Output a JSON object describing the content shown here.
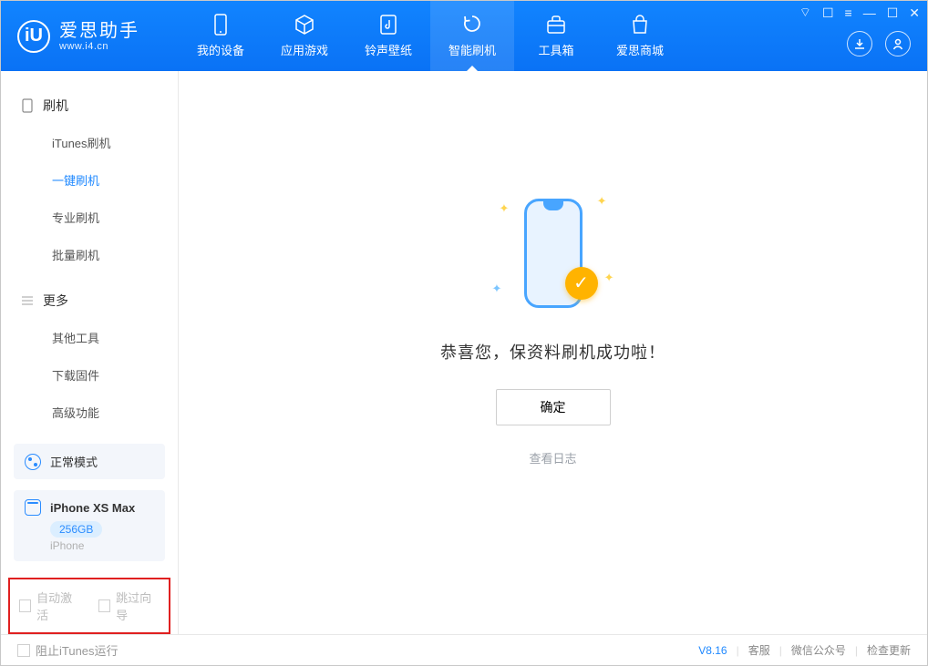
{
  "app": {
    "name_cn": "爱思助手",
    "url": "www.i4.cn"
  },
  "nav": {
    "device": "我的设备",
    "apps": "应用游戏",
    "ringtone": "铃声壁纸",
    "flash": "智能刷机",
    "toolbox": "工具箱",
    "store": "爱思商城"
  },
  "sidebar": {
    "section_flash": "刷机",
    "items_flash": {
      "itunes": "iTunes刷机",
      "oneclick": "一键刷机",
      "pro": "专业刷机",
      "batch": "批量刷机"
    },
    "section_more": "更多",
    "items_more": {
      "other": "其他工具",
      "firmware": "下载固件",
      "advanced": "高级功能"
    }
  },
  "mode": {
    "label": "正常模式"
  },
  "device": {
    "name": "iPhone XS Max",
    "storage": "256GB",
    "type": "iPhone"
  },
  "checks": {
    "auto_activate": "自动激活",
    "skip_guide": "跳过向导"
  },
  "main": {
    "success_message": "恭喜您，保资料刷机成功啦！",
    "ok": "确定",
    "view_log": "查看日志"
  },
  "status": {
    "block_itunes": "阻止iTunes运行",
    "version": "V8.16",
    "support": "客服",
    "wechat": "微信公众号",
    "update": "检查更新"
  }
}
